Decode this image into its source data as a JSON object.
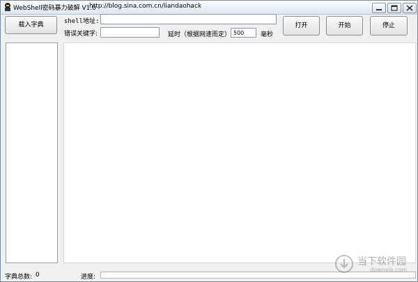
{
  "window": {
    "title": "WebShell密码暴力破解 V1.0",
    "url_caption": "http://blog.sina.com.cn/liandaohack"
  },
  "buttons": {
    "load_dict": "载入字典",
    "open": "打开",
    "start": "开始",
    "stop": "停止"
  },
  "form": {
    "shell_label": "shell地址:",
    "shell_value": "",
    "error_keyword_label": "错误关键字:",
    "error_keyword_value": "",
    "delay_label": "延时（根据网速而定）:",
    "delay_value": "500",
    "delay_unit": "毫秒"
  },
  "status": {
    "dict_count_label": "字典总数:",
    "dict_count_value": "0",
    "progress_label": "进度:",
    "progress_fraction": 0
  },
  "watermark": {
    "text": "当下软件园",
    "sub": "downxia.com"
  },
  "colors": {
    "window_bg": "#f0f0f0",
    "panel_bg": "#ffffff"
  }
}
